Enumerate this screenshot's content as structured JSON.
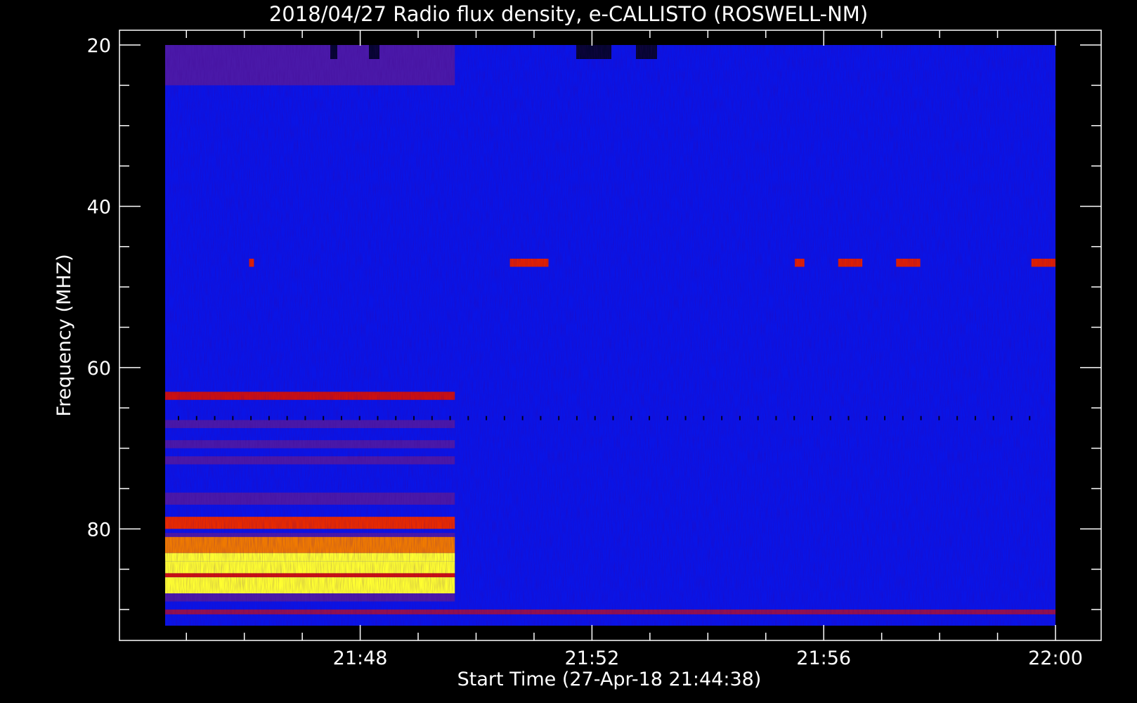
{
  "chart_data": {
    "type": "heatmap",
    "title": "2018/04/27  Radio flux density, e-CALLISTO (ROSWELL-NM)",
    "xlabel": "Start Time (27-Apr-18 21:44:38)",
    "ylabel": "Frequency (MHZ)",
    "x_range_minutes": [
      "21:44:38",
      "22:00:00"
    ],
    "y_range_mhz": [
      92,
      20
    ],
    "x_ticks": [
      "21:48",
      "21:52",
      "21:56",
      "22:00"
    ],
    "y_ticks": [
      20,
      40,
      60,
      80
    ],
    "y_axis_inverted": true,
    "colormap": [
      "#0000ff",
      "#3a1a9a",
      "#7a1a6a",
      "#cc0000",
      "#ff6000",
      "#ffff30"
    ],
    "background_color": "#0a14e6",
    "features": {
      "early_segment_end_time": "21:49:38",
      "early_bands": [
        {
          "mhz": [
            20,
            25
          ],
          "level": "purple"
        },
        {
          "mhz": [
            63,
            64
          ],
          "level": "red"
        },
        {
          "mhz": [
            66.5,
            67.5
          ],
          "level": "purple"
        },
        {
          "mhz": [
            69,
            70
          ],
          "level": "purple"
        },
        {
          "mhz": [
            71,
            72
          ],
          "level": "purple"
        },
        {
          "mhz": [
            75.5,
            77
          ],
          "level": "purple"
        },
        {
          "mhz": [
            78.5,
            80
          ],
          "level": "red-orange"
        },
        {
          "mhz": [
            80.5,
            81
          ],
          "level": "purple"
        },
        {
          "mhz": [
            81,
            83
          ],
          "level": "orange"
        },
        {
          "mhz": [
            83,
            84
          ],
          "level": "yellow"
        },
        {
          "mhz": [
            84,
            85.5
          ],
          "level": "yellow"
        },
        {
          "mhz": [
            85.5,
            86
          ],
          "level": "red"
        },
        {
          "mhz": [
            86,
            88
          ],
          "level": "yellow"
        },
        {
          "mhz": [
            88,
            89
          ],
          "level": "purple"
        }
      ],
      "full_bands": [
        {
          "mhz": [
            90,
            90.6
          ],
          "level": "red"
        }
      ],
      "bursts_47mhz": [
        {
          "time": [
            "21:46:05",
            "21:46:10"
          ]
        },
        {
          "time": [
            "21:50:35",
            "21:51:15"
          ]
        },
        {
          "time": [
            "21:55:30",
            "21:55:40"
          ]
        },
        {
          "time": [
            "21:56:15",
            "21:56:40"
          ]
        },
        {
          "time": [
            "21:57:15",
            "21:57:40"
          ]
        },
        {
          "time": [
            "21:59:35",
            "22:00:00"
          ]
        }
      ]
    }
  }
}
